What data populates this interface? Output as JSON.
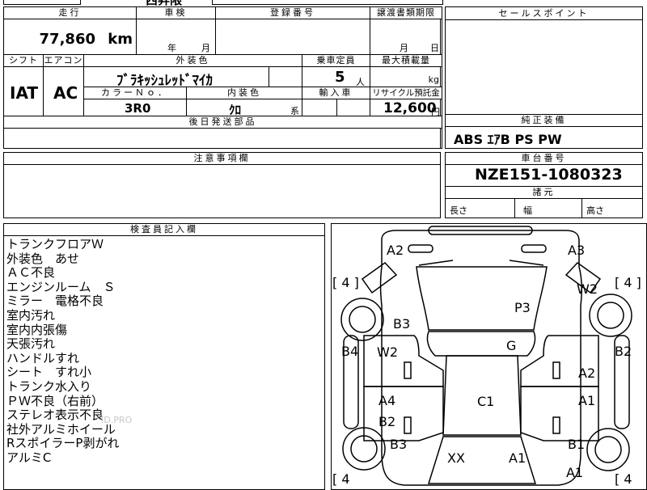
{
  "top_strip_fragment": "西昇限",
  "mileage": {
    "label": "走行",
    "value": "77,860",
    "unit": "km"
  },
  "inspection": {
    "label": "車検",
    "year": "年",
    "month": "月"
  },
  "registration": {
    "label": "登録番号",
    "value": ""
  },
  "transfer_deadline": {
    "label": "譲渡書類期限",
    "month": "月",
    "day": "日"
  },
  "sales_points": {
    "label": "セールスポイント"
  },
  "shift": {
    "label": "シフト",
    "value": "IAT"
  },
  "aircon": {
    "label": "エアコン",
    "value": "AC"
  },
  "exterior_color": {
    "label": "外装色",
    "value": "ﾌﾞﾗｷｯｼｭﾚｯﾄﾞﾏｲｶ"
  },
  "capacity": {
    "label": "乗車定員",
    "value": "5",
    "unit": "人"
  },
  "max_load": {
    "label": "最大積載量",
    "unit": "kg"
  },
  "color_no": {
    "label": "カラーＮｏ．",
    "value": "3R0"
  },
  "interior_color": {
    "label": "内装色",
    "value": "ｸﾛ",
    "suffix": "系"
  },
  "import_car": {
    "label": "輸入車"
  },
  "recycle_fee": {
    "label": "リサイクル預託金",
    "value": "12,600",
    "unit": "円"
  },
  "later_parts": {
    "label": "後日発送部品"
  },
  "genuine_equipment": {
    "label": "純正装備",
    "value": "ABS ｴｱB PS PW"
  },
  "notes": {
    "label": "注意事項欄"
  },
  "chassis_number": {
    "label": "車台番号",
    "value": "NZE151-1080323"
  },
  "dimensions": {
    "label": "諸元",
    "length": "長さ",
    "width": "幅",
    "height": "高さ"
  },
  "inspector_notes": {
    "label": "検査員記入欄",
    "lines": [
      "トランクフロアＷ",
      "外装色　あせ",
      "ＡＣ不良",
      "エンジンルーム　Ｓ",
      "ミラー　電格不良",
      "室内汚れ",
      "室内内張傷",
      "天張汚れ",
      "ハンドルすれ",
      "シート　すれ小",
      "トランク水入り",
      "ＰＷ不良（右前）",
      "ステレオ表示不良",
      "社外アルミホイール",
      "RスポイラーP剥がれ",
      "アルミC"
    ]
  },
  "watermark": "ID.PRO",
  "diagram": {
    "tire_marks": {
      "front_left": "[ 4 ]",
      "front_right": "[ 4 ]",
      "rear_left": "[ 4",
      "rear_right": "[ 4"
    },
    "labels": {
      "a2_top_left": "A2",
      "a3_top_right": "A3",
      "w2_right_fender": "W2",
      "p3_hood": "P3",
      "b3_left_fender": "B3",
      "b4_left_side": "B4",
      "w2_left_door": "W2",
      "g_windshield": "G",
      "b2_right_side": "B2",
      "a2_right_door": "A2",
      "c1_roof": "C1",
      "a4_left_rear_door": "A4",
      "a1_right_rear_door": "A1",
      "b2_left_rear_door": "B2",
      "b3_left_rear_fender": "B3",
      "b1_right_rear_fender": "B1",
      "xx_rear_window": "XX",
      "a1_trunk": "A1",
      "a1_rear_corner": "A1"
    }
  }
}
